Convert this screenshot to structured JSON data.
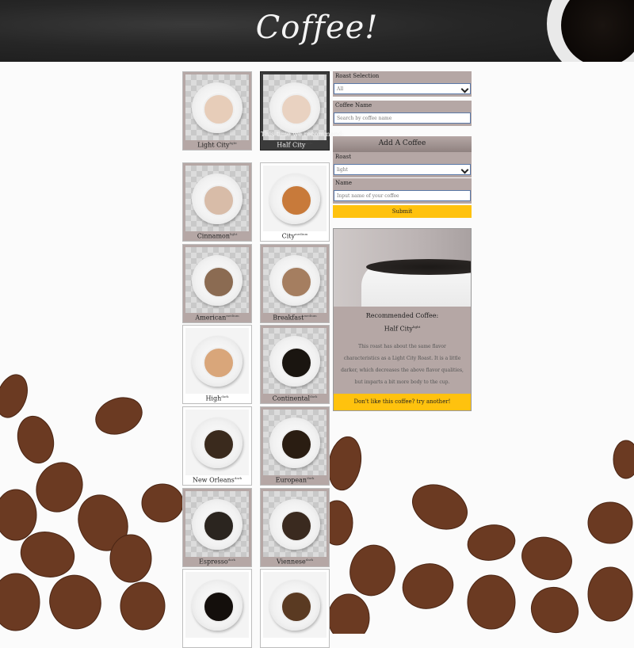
{
  "header": {
    "title": "Coffee!"
  },
  "coffees": [
    {
      "name": "Light City",
      "roast": "light"
    },
    {
      "note": "This time we recommend:",
      "name": "Half City",
      "roast": "light"
    },
    {
      "name": "Cinnamon",
      "roast": "light"
    },
    {
      "name": "City",
      "roast": "medium"
    },
    {
      "name": "American",
      "roast": "medium"
    },
    {
      "name": "Breakfast",
      "roast": "medium"
    },
    {
      "name": "High",
      "roast": "dark"
    },
    {
      "name": "Continental",
      "roast": "dark"
    },
    {
      "name": "New Orleans",
      "roast": "dark"
    },
    {
      "name": "European",
      "roast": "dark"
    },
    {
      "name": "Espresso",
      "roast": "dark"
    },
    {
      "name": "Viennese",
      "roast": "dark"
    },
    {
      "name": "",
      "roast": ""
    },
    {
      "name": "",
      "roast": ""
    }
  ],
  "filters": {
    "roast_label": "Roast Selection",
    "roast_value": "All",
    "name_label": "Coffee Name",
    "name_placeholder": "Search by coffee name"
  },
  "add_form": {
    "heading": "Add A Coffee",
    "roast_label": "Roast",
    "roast_value": "light",
    "name_label": "Name",
    "name_placeholder": "Input name of your coffee",
    "submit_label": "Submit"
  },
  "recommended": {
    "title": "Recommended Coffee:",
    "name": "Half City",
    "roast": "light",
    "description": "This roast has about the same flavor characteristics as a Light City Roast. It is a little darker, which decreases the above flavor qualities, but imparts a bit more body to the cup.",
    "another_label": "Don't like this coffee? try another!"
  },
  "colors": {
    "card": "#b5a7a5",
    "accent": "#ffc20e",
    "recommend": "#3b3b3b"
  }
}
